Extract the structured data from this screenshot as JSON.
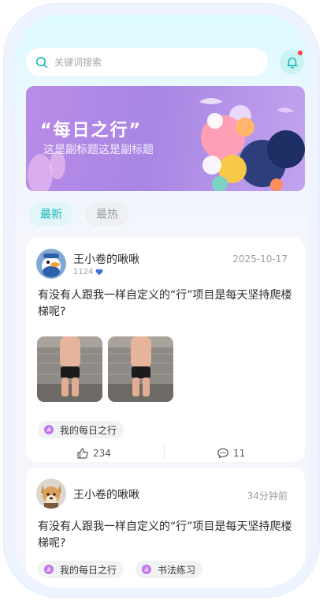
{
  "search": {
    "placeholder": "关键词搜索"
  },
  "banner": {
    "title": "“每日之行”",
    "subtitle": "这是副标题这是副标题"
  },
  "tabs": [
    {
      "label": "最新",
      "active": true
    },
    {
      "label": "最热",
      "active": false
    }
  ],
  "posts": [
    {
      "username": "王小卷的啾啾",
      "meta_count": "1124",
      "time": "2025-10-17",
      "content": "有没有人跟我一样自定义的“行”项目是每天坚持爬楼梯呢?",
      "tags": [
        "我的每日之行"
      ],
      "likes": "234",
      "comments": "11"
    },
    {
      "username": "王小卷的啾啾",
      "time": "34分钟前",
      "content": "有没有人跟我一样自定义的“行”项目是每天坚持爬楼梯呢?",
      "tags": [
        "我的每日之行",
        "书法练习"
      ]
    }
  ],
  "colors": {
    "accent": "#1bb8b9",
    "tag_icon": "#c176ec",
    "notification_dot": "#ff3b4a"
  }
}
